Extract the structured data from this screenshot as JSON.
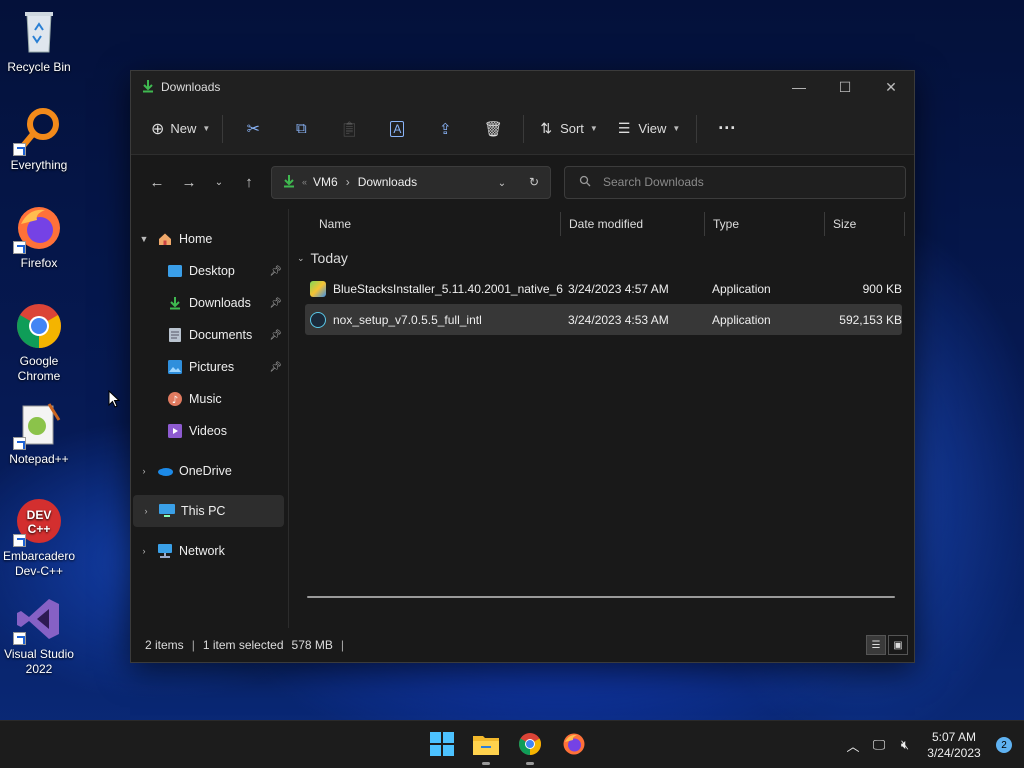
{
  "desktop": {
    "icons": [
      {
        "label": "Recycle Bin",
        "icon": "recycle-bin-icon"
      },
      {
        "label": "Everything",
        "icon": "everything-icon"
      },
      {
        "label": "Firefox",
        "icon": "firefox-icon"
      },
      {
        "label": "Google Chrome",
        "icon": "chrome-icon"
      },
      {
        "label": "Notepad++",
        "icon": "notepadpp-icon"
      },
      {
        "label": "Embarcadero Dev-C++",
        "icon": "devcpp-icon"
      },
      {
        "label": "Visual Studio 2022",
        "icon": "visual-studio-icon"
      }
    ]
  },
  "window": {
    "title": "Downloads",
    "toolbar": {
      "new_label": "New",
      "sort_label": "Sort",
      "view_label": "View"
    },
    "address": {
      "crumbs": [
        "VM6",
        "Downloads"
      ]
    },
    "search": {
      "placeholder": "Search Downloads"
    },
    "sidebar": {
      "items": [
        {
          "label": "Home"
        },
        {
          "label": "Desktop"
        },
        {
          "label": "Downloads"
        },
        {
          "label": "Documents"
        },
        {
          "label": "Pictures"
        },
        {
          "label": "Music"
        },
        {
          "label": "Videos"
        },
        {
          "label": "OneDrive"
        },
        {
          "label": "This PC"
        },
        {
          "label": "Network"
        }
      ]
    },
    "columns": [
      "Name",
      "Date modified",
      "Type",
      "Size"
    ],
    "group_label": "Today",
    "files": [
      {
        "name": "BlueStacksInstaller_5.11.40.2001_native_6...",
        "date": "3/24/2023 4:57 AM",
        "type": "Application",
        "size": "900 KB"
      },
      {
        "name": "nox_setup_v7.0.5.5_full_intl",
        "date": "3/24/2023 4:53 AM",
        "type": "Application",
        "size": "592,153 KB"
      }
    ],
    "status": {
      "count": "2 items",
      "selection": "1 item selected",
      "size": "578 MB"
    }
  },
  "taskbar": {
    "time": "5:07 AM",
    "date": "3/24/2023",
    "notification_count": "2"
  },
  "colors": {
    "accent": "#0078d4",
    "folder_yellow": "#f2c94c",
    "download_green": "#3fb950"
  }
}
